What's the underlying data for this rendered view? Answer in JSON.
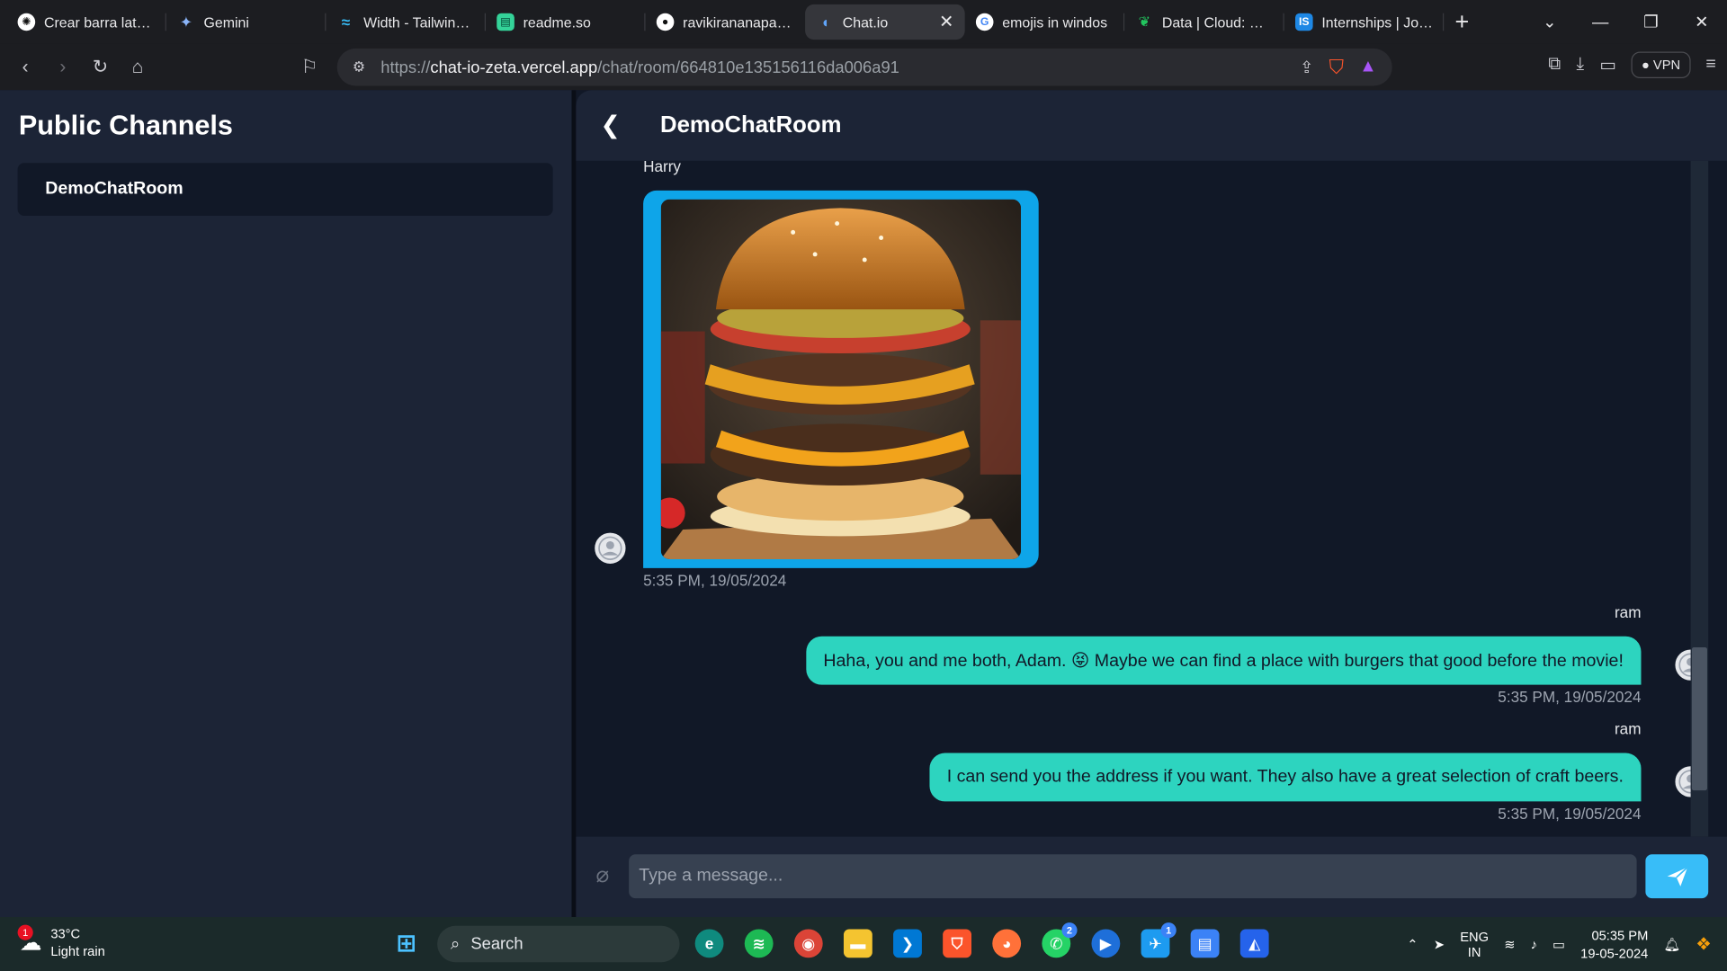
{
  "browser": {
    "tabs": [
      {
        "title": "Crear barra lateral",
        "icon": "openai-icon"
      },
      {
        "title": "Gemini",
        "icon": "gemini-icon"
      },
      {
        "title": "Width - Tailwind CSS",
        "icon": "tailwind-icon"
      },
      {
        "title": "readme.so",
        "icon": "readme-icon"
      },
      {
        "title": "ravikirananaparthi",
        "icon": "github-icon"
      },
      {
        "title": "Chat.io",
        "icon": "chat-icon",
        "active": true
      },
      {
        "title": "emojis in windos",
        "icon": "google-icon"
      },
      {
        "title": "Data | Cloud: Mon",
        "icon": "mongodb-icon"
      },
      {
        "title": "Internships | Jobs",
        "icon": "internshala-icon"
      }
    ],
    "url_scheme": "https://",
    "url_host": "chat-io-zeta.vercel.app",
    "url_path": "/chat/room/664810e135156116da006a91",
    "vpn_label": "VPN"
  },
  "sidebar": {
    "title": "Public Channels",
    "channels": [
      {
        "name": "DemoChatRoom"
      }
    ]
  },
  "chat": {
    "room_name": "DemoChatRoom",
    "messages": [
      {
        "sender": "Harry",
        "type": "image",
        "image_subject": "burger",
        "time": "5:35 PM, 19/05/2024"
      },
      {
        "sender": "ram",
        "type": "text",
        "text": "Haha, you and me both, Adam. 😝 Maybe we can find a place with burgers that good before the movie!",
        "time": "5:35 PM, 19/05/2024"
      },
      {
        "sender": "ram",
        "type": "text",
        "text": "I can send you the address if you want. They also have a great selection of craft beers.",
        "time": "5:35 PM, 19/05/2024"
      }
    ],
    "input_placeholder": "Type a message..."
  },
  "taskbar": {
    "weather_temp": "33°C",
    "weather_desc": "Light rain",
    "weather_badge": "1",
    "search_label": "Search",
    "whatsapp_badge": "2",
    "twitter_badge": "1",
    "lang_line1": "ENG",
    "lang_line2": "IN",
    "time": "05:35 PM",
    "date": "19-05-2024"
  },
  "colors": {
    "sent_bubble": "#2dd4bf",
    "image_bubble": "#0ea5e9",
    "send_button": "#38bdf8",
    "chat_bg": "#111827",
    "sidebar_bg": "#1c2436"
  }
}
